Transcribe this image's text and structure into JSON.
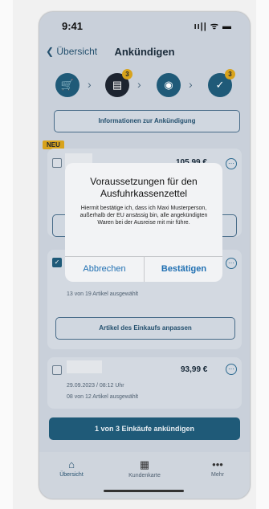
{
  "status": {
    "time": "9:41",
    "system": "ıı|| ᯤ ▬"
  },
  "nav": {
    "back_label": "Übersicht",
    "title": "Ankündigen"
  },
  "steps": [
    {
      "icon": "cart-icon",
      "glyph": "🛒",
      "badge": ""
    },
    {
      "icon": "receipt-icon",
      "glyph": "▤",
      "badge": "3"
    },
    {
      "icon": "customs-officer-icon",
      "glyph": "◉",
      "badge": ""
    },
    {
      "icon": "check-document-icon",
      "glyph": "✓",
      "badge": "3"
    }
  ],
  "info_button": "Informationen zur Ankündigung",
  "new_badge": "NEU",
  "purchases": [
    {
      "price": "105,99 €"
    },
    {
      "meta": "13 von 19 Artikel ausgewählt",
      "adjust_label": "Artikel des Einkaufs anpassen"
    },
    {
      "price": "93,99 €",
      "date": "29.09.2023 / 08:12 Uhr",
      "meta": "08 von 12 Artikel ausgewählt"
    }
  ],
  "primary_button": "1 von 3 Einkäufe ankündigen",
  "tabbar": {
    "overview": {
      "label": "Übersicht",
      "icon": "home-icon",
      "glyph": "⌂"
    },
    "card": {
      "label": "Kundenkarte",
      "icon": "qr-code-icon",
      "glyph": "▦"
    },
    "more": {
      "label": "Mehr",
      "icon": "more-icon",
      "glyph": "•••"
    }
  },
  "dialog": {
    "title": "Voraussetzungen für den Ausfuhrkassenzettel",
    "message": "Hiermit bestätige ich, dass ich Maxi Musterperson, außerhalb der EU ansässig bin, alle angekündigten Waren bei der Ausreise mit mir führe.",
    "cancel": "Abbrechen",
    "confirm": "Bestätigen"
  },
  "colors": {
    "primary": "#1f5a78",
    "accent_badge": "#d8a31c",
    "dialog_action": "#1f6fb2"
  }
}
